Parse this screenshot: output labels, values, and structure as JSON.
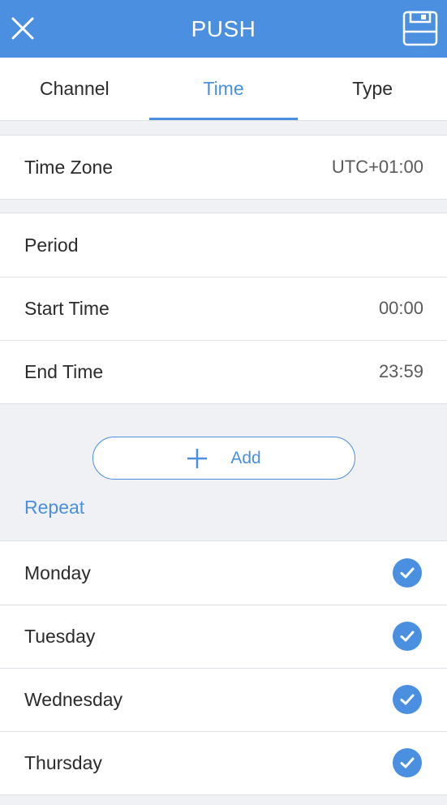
{
  "header": {
    "title": "PUSH",
    "close_icon": "close-icon",
    "save_icon": "floppy-save-icon",
    "background": "#4a8fe0"
  },
  "tabs": [
    {
      "label": "Channel",
      "active": false
    },
    {
      "label": "Time",
      "active": true
    },
    {
      "label": "Type",
      "active": false
    }
  ],
  "timezone": {
    "label": "Time Zone",
    "value": "UTC+01:00"
  },
  "period": {
    "label": "Period",
    "start": {
      "label": "Start Time",
      "value": "00:00"
    },
    "end": {
      "label": "End Time",
      "value": "23:59"
    }
  },
  "add_button": {
    "label": "Add",
    "icon": "plus-icon"
  },
  "repeat": {
    "label": "Repeat",
    "days": [
      {
        "label": "Monday",
        "checked": true
      },
      {
        "label": "Tuesday",
        "checked": true
      },
      {
        "label": "Wednesday",
        "checked": true
      },
      {
        "label": "Thursday",
        "checked": true
      }
    ]
  },
  "colors": {
    "accent": "#4a8fe0",
    "background": "#eff1f5"
  }
}
